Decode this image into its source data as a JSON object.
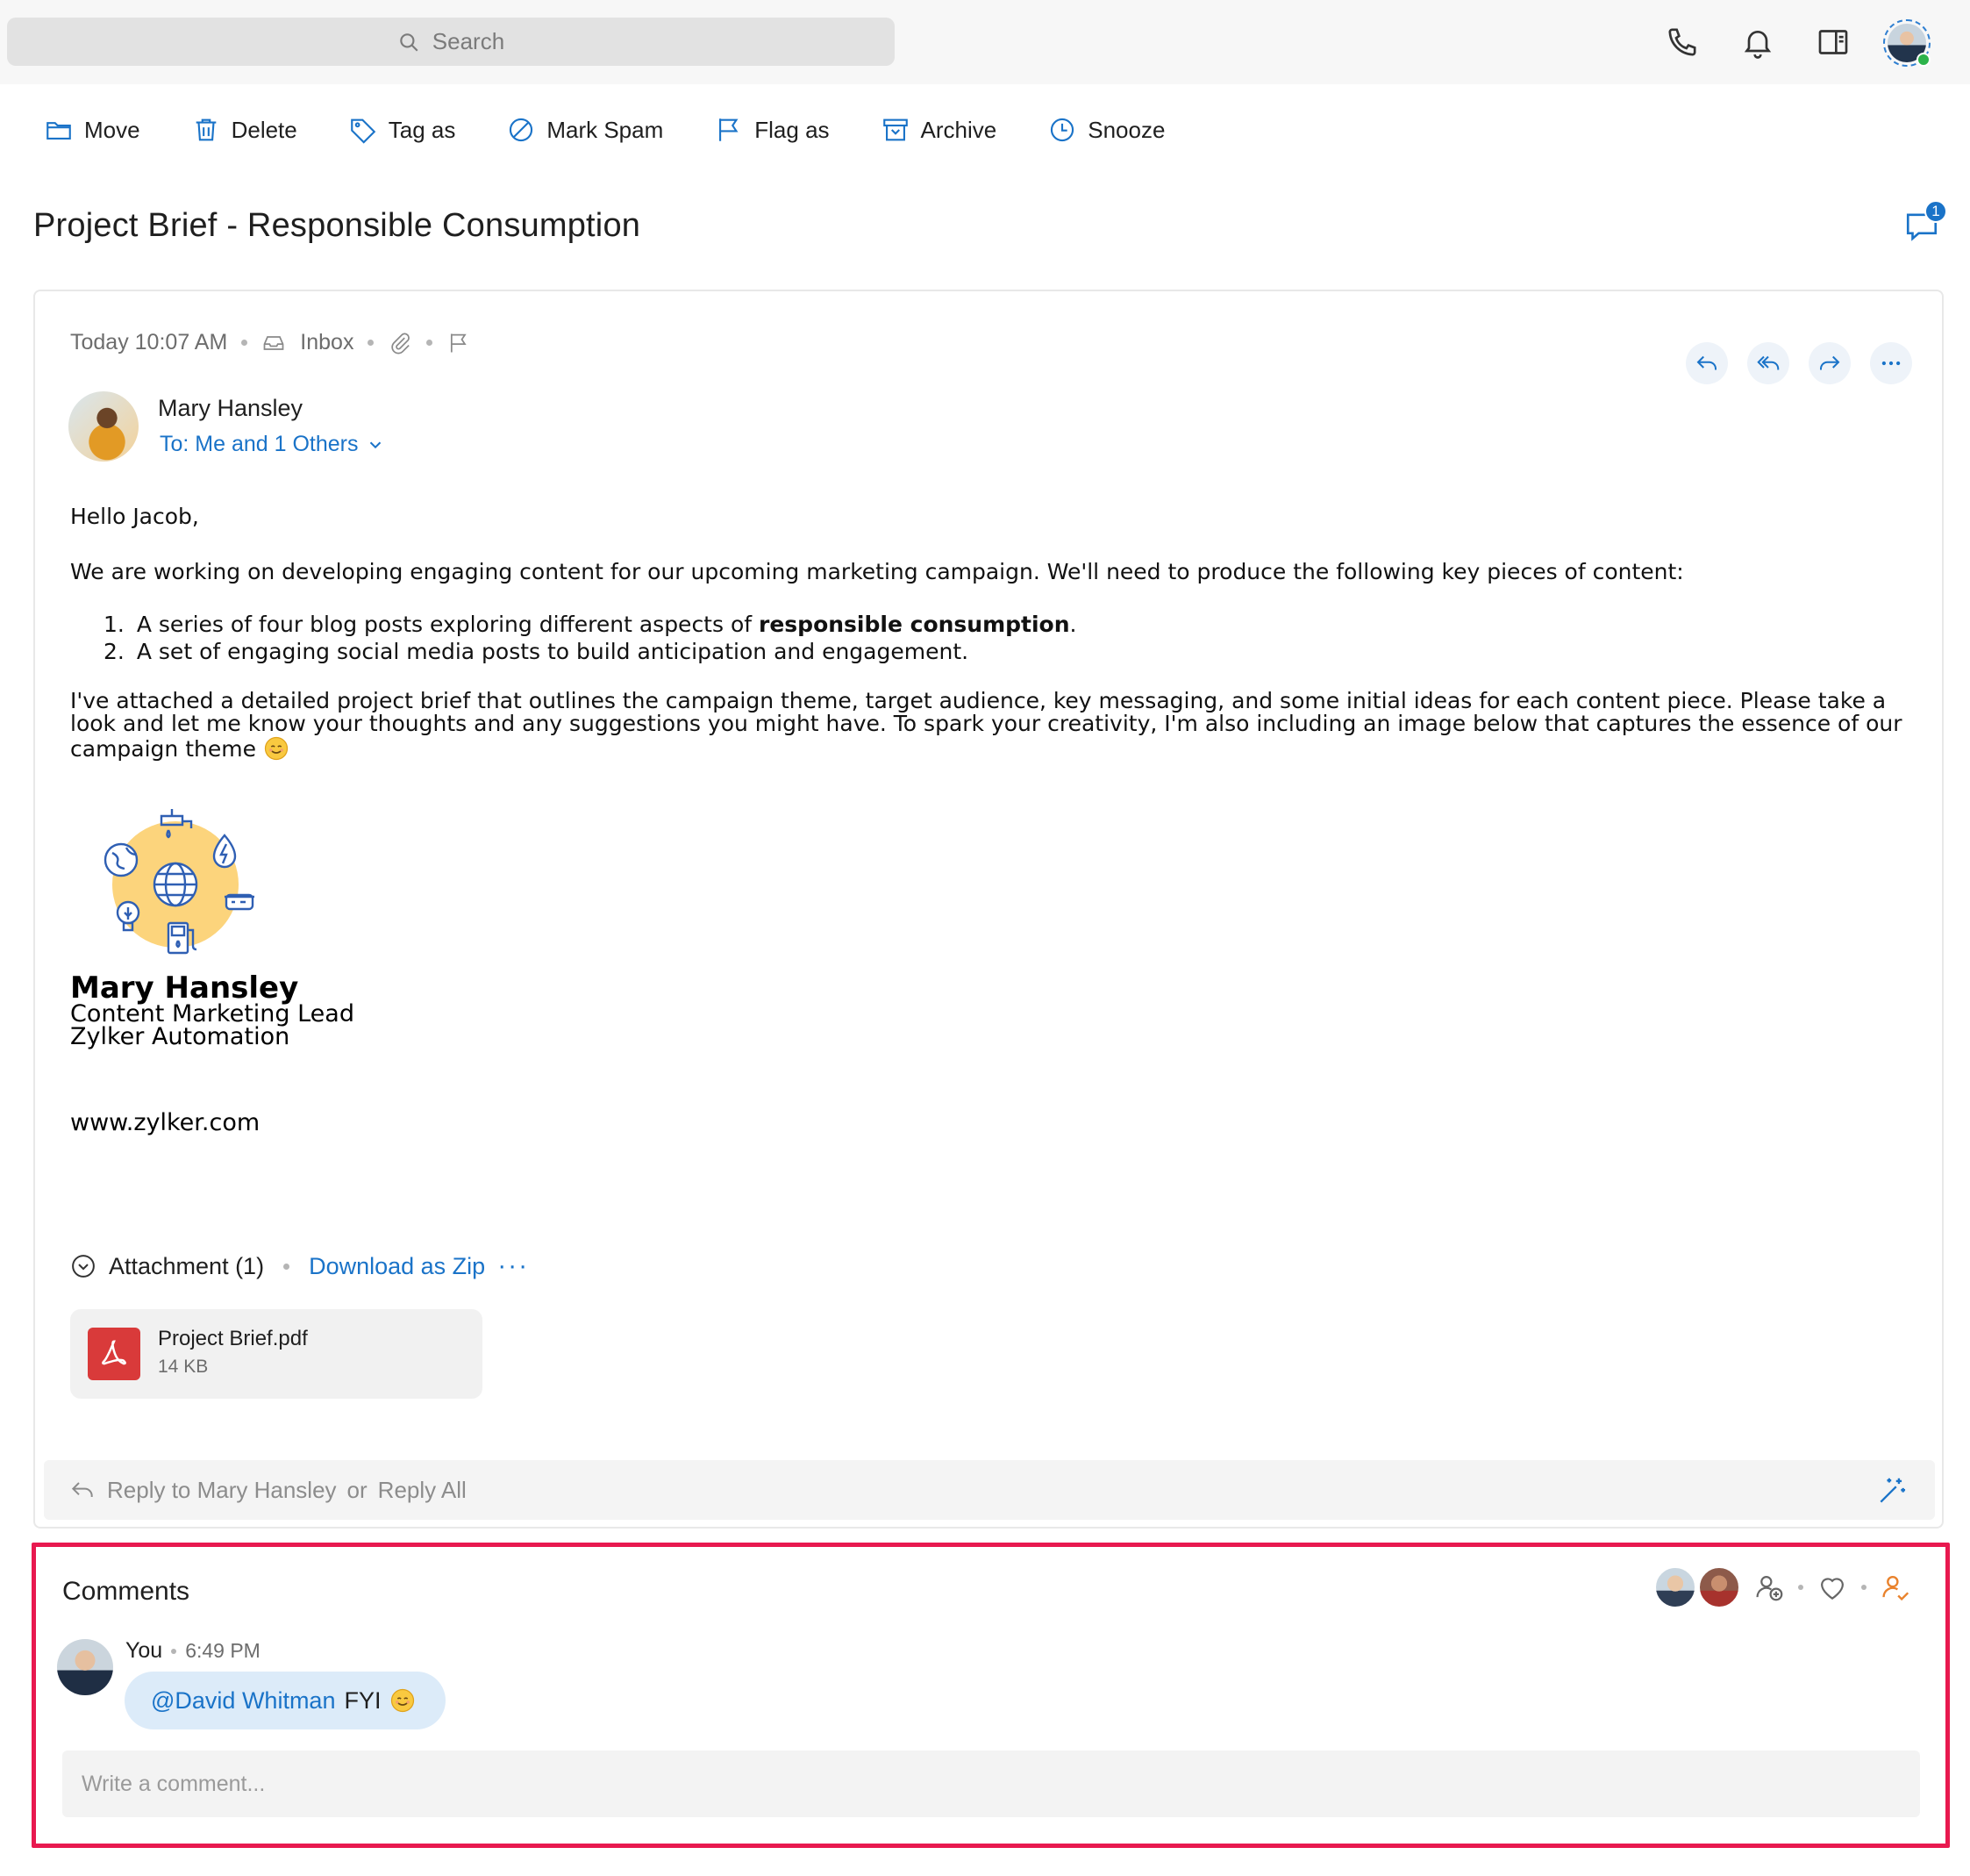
{
  "search": {
    "placeholder": "Search"
  },
  "header_icons": [
    "phone-icon",
    "bell-icon",
    "reading-pane-icon",
    "profile-avatar"
  ],
  "toolbar": {
    "move": "Move",
    "delete": "Delete",
    "tag": "Tag as",
    "spam": "Mark Spam",
    "flag": "Flag as",
    "archive": "Archive",
    "snooze": "Snooze"
  },
  "mail": {
    "subject": "Project Brief - Responsible Consumption",
    "comment_count": "1",
    "time": "Today 10:07 AM",
    "folder": "Inbox",
    "sender": "Mary Hansley",
    "to": "To: Me and 1 Others",
    "greeting": "Hello Jacob,",
    "para1": "We are working on developing engaging content for our upcoming marketing campaign. We'll need to produce the following key pieces of content:",
    "list": [
      {
        "num": "1.",
        "pre": "A series of four blog posts exploring different aspects of ",
        "bold": "responsible consumption",
        "post": "."
      },
      {
        "num": "2.",
        "pre": "A set of engaging social media posts to build anticipation and engagement.",
        "bold": "",
        "post": ""
      }
    ],
    "para2": "I've attached a detailed project brief that outlines the campaign theme, target audience, key messaging, and some initial ideas for each content piece. Please take a look and let me know your thoughts and any suggestions you might have. To spark your creativity, I'm also including an image below that captures the essence of our campaign theme",
    "signature": {
      "name": "Mary Hansley",
      "title": "Content Marketing Lead",
      "company": "Zylker Automation",
      "website": "www.zylker.com"
    }
  },
  "attachments": {
    "heading": "Attachment (1)",
    "download": "Download as Zip",
    "more": "···",
    "files": [
      {
        "name": "Project Brief.pdf",
        "size": "14 KB"
      }
    ]
  },
  "reply": {
    "reply_to": "Reply to Mary Hansley",
    "or": "or",
    "reply_all": "Reply All"
  },
  "comments": {
    "title": "Comments",
    "items": [
      {
        "author": "You",
        "time": "6:49 PM",
        "mention": "@David Whitman",
        "text": "FYI"
      }
    ],
    "placeholder": "Write a comment..."
  },
  "colors": {
    "accent": "#1a73c8",
    "highlight_border": "#e8194f",
    "pdf": "#d93a3a"
  }
}
